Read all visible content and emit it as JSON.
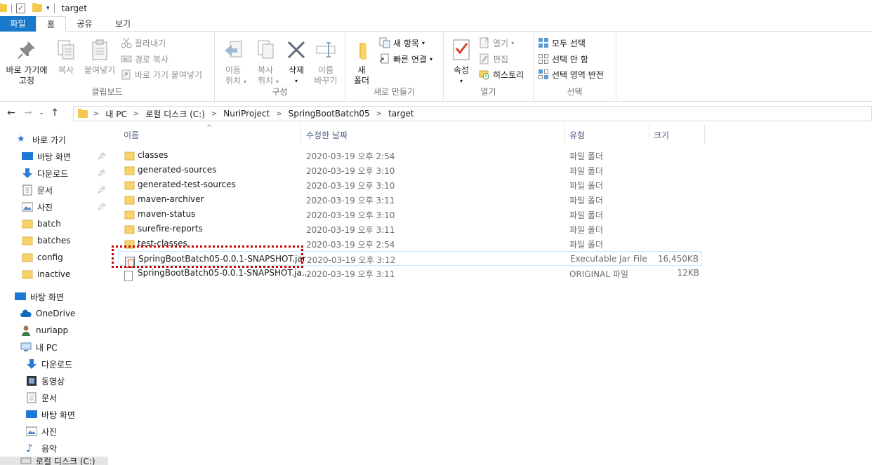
{
  "window": {
    "title": "target"
  },
  "tabs": [
    "파일",
    "홈",
    "공유",
    "보기"
  ],
  "ribbon": {
    "clipboard": {
      "pin_label": "바로 가기에\n고정",
      "copy": "복사",
      "paste": "붙여넣기",
      "cut": "잘라내기",
      "copy_path": "경로 복사",
      "paste_shortcut": "바로 가기 붙여넣기",
      "group": "클립보드"
    },
    "organize": {
      "move_to": "이동\n위치",
      "copy_to": "복사\n위치",
      "delete": "삭제",
      "rename": "이름\n바꾸기",
      "group": "구성"
    },
    "new": {
      "new_folder": "새\n폴더",
      "new_item": "새 항목",
      "easy_access": "빠른 연결",
      "group": "새로 만들기"
    },
    "open": {
      "properties": "속성",
      "open": "열기",
      "edit": "편집",
      "history": "히스토리",
      "group": "열기"
    },
    "select": {
      "select_all": "모두 선택",
      "select_none": "선택 안 함",
      "invert": "선택 영역 반전",
      "group": "선택"
    }
  },
  "address": {
    "crumbs": [
      "내 PC",
      "로컬 디스크 (C:)",
      "NuriProject",
      "SpringBootBatch05",
      "target"
    ]
  },
  "nav": {
    "quick_access": "바로 가기",
    "pinned": [
      "바탕 화면",
      "다운로드",
      "문서",
      "사진"
    ],
    "folders": [
      "batch",
      "batches",
      "config",
      "inactive"
    ],
    "desktop": "바탕 화면",
    "onedrive": "OneDrive",
    "user": "nuriapp",
    "this_pc": "내 PC",
    "pc_items": [
      "다운로드",
      "동영상",
      "문서",
      "바탕 화면",
      "사진",
      "음악"
    ],
    "local_disk": "로컬 디스크 (C:)"
  },
  "columns": {
    "name": "이름",
    "date": "수정한 날짜",
    "type": "유형",
    "size": "크기"
  },
  "files": [
    {
      "name": "classes",
      "date": "2020-03-19 오후 2:54",
      "type": "파일 폴더",
      "size": "",
      "kind": "folder"
    },
    {
      "name": "generated-sources",
      "date": "2020-03-19 오후 3:10",
      "type": "파일 폴더",
      "size": "",
      "kind": "folder"
    },
    {
      "name": "generated-test-sources",
      "date": "2020-03-19 오후 3:10",
      "type": "파일 폴더",
      "size": "",
      "kind": "folder"
    },
    {
      "name": "maven-archiver",
      "date": "2020-03-19 오후 3:11",
      "type": "파일 폴더",
      "size": "",
      "kind": "folder"
    },
    {
      "name": "maven-status",
      "date": "2020-03-19 오후 3:10",
      "type": "파일 폴더",
      "size": "",
      "kind": "folder"
    },
    {
      "name": "surefire-reports",
      "date": "2020-03-19 오후 3:11",
      "type": "파일 폴더",
      "size": "",
      "kind": "folder"
    },
    {
      "name": "test-classes",
      "date": "2020-03-19 오후 2:54",
      "type": "파일 폴더",
      "size": "",
      "kind": "folder"
    },
    {
      "name": "SpringBootBatch05-0.0.1-SNAPSHOT.jar",
      "date": "2020-03-19 오후 3:12",
      "type": "Executable Jar File",
      "size": "16,450KB",
      "kind": "jar"
    },
    {
      "name": "SpringBootBatch05-0.0.1-SNAPSHOT.ja...",
      "date": "2020-03-19 오후 3:11",
      "type": "ORIGINAL 파일",
      "size": "12KB",
      "kind": "file"
    }
  ]
}
